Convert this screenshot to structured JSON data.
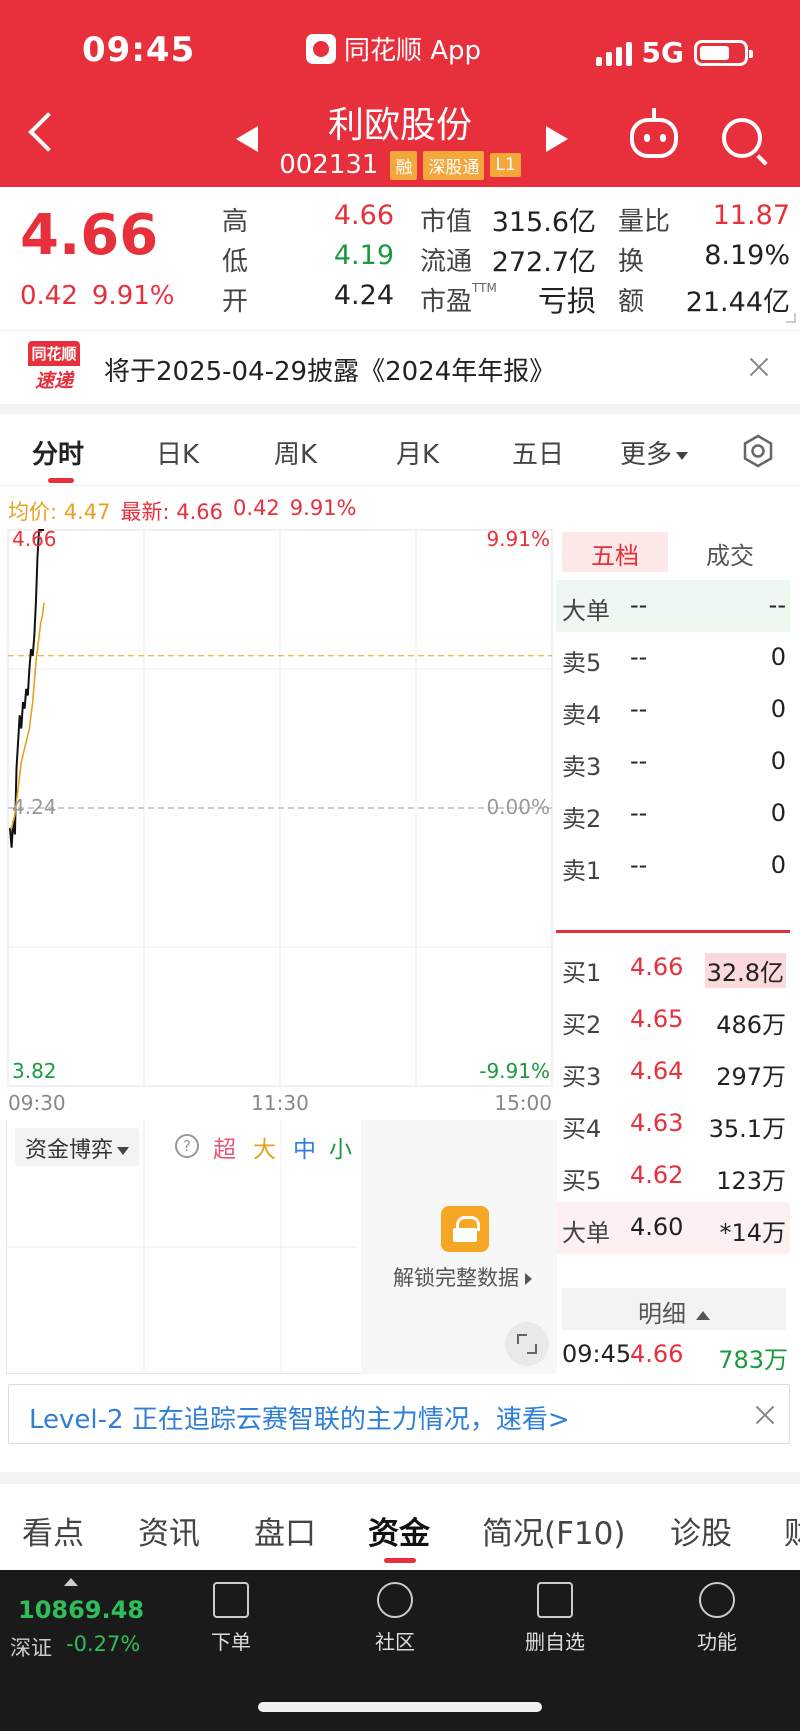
{
  "status_bar": {
    "time": "09:45",
    "app_name": "同花顺 App",
    "network": "5G"
  },
  "header": {
    "stock_name": "利欧股份",
    "stock_code": "002131",
    "tags": [
      "融",
      "深股通",
      "L1"
    ]
  },
  "quote": {
    "price": "4.66",
    "change": "0.42",
    "change_pct": "9.91%",
    "fields": [
      {
        "label": "高",
        "value": "4.66",
        "color": "#e8303c"
      },
      {
        "label": "低",
        "value": "4.19",
        "color": "#1a9a3e"
      },
      {
        "label": "开",
        "value": "4.24",
        "color": "#222222"
      },
      {
        "label": "市值",
        "value": "315.6亿",
        "color": "#222222"
      },
      {
        "label": "流通",
        "value": "272.7亿",
        "color": "#222222"
      },
      {
        "label": "市盈",
        "label_sup": "TTM",
        "value": "亏损",
        "color": "#222222"
      },
      {
        "label": "量比",
        "value": "11.87",
        "color": "#e8303c"
      },
      {
        "label": "换",
        "value": "8.19%",
        "color": "#222222"
      },
      {
        "label": "额",
        "value": "21.44亿",
        "color": "#222222"
      }
    ]
  },
  "news": {
    "logo_top": "同花顺",
    "logo_bottom": "速递",
    "text": "将于2025-04-29披露《2024年年报》"
  },
  "chart_tabs": [
    "分时",
    "日K",
    "周K",
    "月K",
    "五日",
    "更多"
  ],
  "chart_info": {
    "avg_label": "均价: 4.47",
    "latest_label": "最新: 4.66",
    "change": "0.42",
    "change_pct": "9.91%"
  },
  "chart_data": {
    "type": "line",
    "y_labels_left": [
      "4.66",
      "4.24",
      "3.82"
    ],
    "y_labels_right": [
      "9.91%",
      "0.00%",
      "-9.91%"
    ],
    "x_labels": [
      "09:30",
      "11:30",
      "15:00"
    ],
    "ylim": [
      3.82,
      4.66
    ],
    "prev_close": 4.24,
    "avg_level": 4.47,
    "series": [
      {
        "values": [
          4.21,
          4.18,
          4.22,
          4.2,
          4.3,
          4.34,
          4.38,
          4.36,
          4.4,
          4.39,
          4.42,
          4.41,
          4.45,
          4.48,
          4.47,
          4.5,
          4.55,
          4.62,
          4.66,
          4.66,
          4.66,
          4.66
        ],
        "color": "#111111"
      },
      {
        "values": [
          4.21,
          4.21,
          4.22,
          4.23,
          4.25,
          4.27,
          4.29,
          4.31,
          4.32,
          4.33,
          4.34,
          4.35,
          4.36,
          4.38,
          4.4,
          4.43,
          4.46,
          4.48,
          4.5,
          4.52,
          4.53,
          4.55
        ],
        "color": "#e6a21f"
      }
    ]
  },
  "order_book": {
    "tabs": [
      "五档",
      "成交"
    ],
    "big_sell": {
      "label": "大单",
      "price": "--",
      "volume": "--"
    },
    "asks": [
      {
        "label": "卖5",
        "price": "--",
        "volume": "0"
      },
      {
        "label": "卖4",
        "price": "--",
        "volume": "0"
      },
      {
        "label": "卖3",
        "price": "--",
        "volume": "0"
      },
      {
        "label": "卖2",
        "price": "--",
        "volume": "0"
      },
      {
        "label": "卖1",
        "price": "--",
        "volume": "0"
      }
    ],
    "bids": [
      {
        "label": "买1",
        "price": "4.66",
        "volume": "32.8亿"
      },
      {
        "label": "买2",
        "price": "4.65",
        "volume": "486万"
      },
      {
        "label": "买3",
        "price": "4.64",
        "volume": "297万"
      },
      {
        "label": "买4",
        "price": "4.63",
        "volume": "35.1万"
      },
      {
        "label": "买5",
        "price": "4.62",
        "volume": "123万"
      }
    ],
    "big_buy": {
      "label": "大单",
      "price": "4.60",
      "volume": "*14万"
    },
    "detail_label": "明细",
    "last_trade": {
      "time": "09:45",
      "price": "4.66",
      "volume": "783万"
    }
  },
  "fund": {
    "select_label": "资金博弈",
    "help": "?",
    "legend": [
      {
        "label": "超",
        "color": "#e8567a"
      },
      {
        "label": "大",
        "color": "#e6a21f"
      },
      {
        "label": "中",
        "color": "#2f7fd6"
      },
      {
        "label": "小",
        "color": "#1a9a3e"
      }
    ],
    "unlock_text": "解锁完整数据"
  },
  "level2_banner": "Level-2 正在追踪云赛智联的主力情况，速看>",
  "bottom_tabs": [
    "看点",
    "资讯",
    "盘口",
    "资金",
    "简况(F10)",
    "诊股",
    "财"
  ],
  "bottom_bar": {
    "index_value": "10869.48",
    "index_name": "深证",
    "index_change": "-0.27%",
    "items": [
      "下单",
      "社区",
      "删自选",
      "功能"
    ]
  }
}
